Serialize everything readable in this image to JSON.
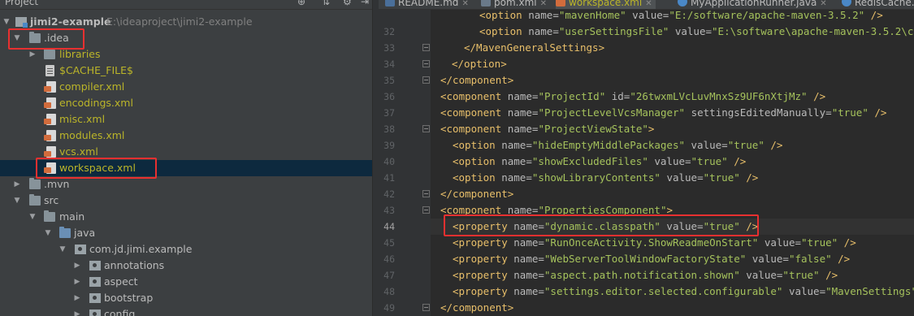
{
  "project_panel": {
    "title": "Project",
    "root": {
      "name": "jimi2-example",
      "path": "E:\\ideaproject\\jimi2-example"
    },
    "rows": [
      {
        "label": ".idea"
      },
      {
        "label": "libraries"
      },
      {
        "label": "$CACHE_FILE$"
      },
      {
        "label": "compiler.xml"
      },
      {
        "label": "encodings.xml"
      },
      {
        "label": "misc.xml"
      },
      {
        "label": "modules.xml"
      },
      {
        "label": "vcs.xml"
      },
      {
        "label": "workspace.xml"
      },
      {
        "label": ".mvn"
      },
      {
        "label": "src"
      },
      {
        "label": "main"
      },
      {
        "label": "java"
      },
      {
        "label": "com.jd.jimi.example"
      },
      {
        "label": "annotations"
      },
      {
        "label": "aspect"
      },
      {
        "label": "bootstrap"
      },
      {
        "label": "config"
      }
    ]
  },
  "tabs": [
    {
      "label": "README.md"
    },
    {
      "label": "pom.xml"
    },
    {
      "label": "workspace.xml"
    },
    {
      "label": "MyApplicationRunner.java"
    },
    {
      "label": "RedisCache."
    }
  ],
  "editor": {
    "lines": [
      {
        "n": "",
        "s": [
          {
            "t": "<option ",
            "c": "t-tag"
          },
          {
            "t": "name=",
            "c": "t-attr"
          },
          {
            "t": "\"mavenHome\" ",
            "c": "t-val"
          },
          {
            "t": "value=",
            "c": "t-attr"
          },
          {
            "t": "\"E:/software/apache-maven-3.5.2\"",
            "c": "t-val"
          },
          {
            "t": " />",
            "c": "t-tag"
          }
        ]
      },
      {
        "n": "32",
        "s": [
          {
            "t": "<option ",
            "c": "t-tag"
          },
          {
            "t": "name=",
            "c": "t-attr"
          },
          {
            "t": "\"userSettingsFile\" ",
            "c": "t-val"
          },
          {
            "t": "value=",
            "c": "t-attr"
          },
          {
            "t": "\"E:\\software\\apache-maven-3.5.2\\conf\\se",
            "c": "t-val"
          }
        ]
      },
      {
        "n": "33",
        "s": [
          {
            "t": "</MavenGeneralSettings>",
            "c": "t-tag"
          }
        ]
      },
      {
        "n": "34",
        "s": [
          {
            "t": "</option>",
            "c": "t-tag"
          }
        ]
      },
      {
        "n": "35",
        "s": [
          {
            "t": "</component>",
            "c": "t-tag"
          }
        ]
      },
      {
        "n": "36",
        "s": [
          {
            "t": "<component ",
            "c": "t-tag"
          },
          {
            "t": "name=",
            "c": "t-attr"
          },
          {
            "t": "\"ProjectId\" ",
            "c": "t-val"
          },
          {
            "t": "id=",
            "c": "t-attr"
          },
          {
            "t": "\"26twxmLVcLuvMnxSz9UF6nXtjMz\"",
            "c": "t-val"
          },
          {
            "t": " />",
            "c": "t-tag"
          }
        ]
      },
      {
        "n": "37",
        "s": [
          {
            "t": "<component ",
            "c": "t-tag"
          },
          {
            "t": "name=",
            "c": "t-attr"
          },
          {
            "t": "\"ProjectLevelVcsManager\" ",
            "c": "t-val"
          },
          {
            "t": "settingsEditedManually=",
            "c": "t-attr"
          },
          {
            "t": "\"true\"",
            "c": "t-val"
          },
          {
            "t": " />",
            "c": "t-tag"
          }
        ]
      },
      {
        "n": "38",
        "s": [
          {
            "t": "<component ",
            "c": "t-tag"
          },
          {
            "t": "name=",
            "c": "t-attr"
          },
          {
            "t": "\"ProjectViewState\"",
            "c": "t-val"
          },
          {
            "t": ">",
            "c": "t-tag"
          }
        ]
      },
      {
        "n": "39",
        "s": [
          {
            "t": "<option ",
            "c": "t-tag"
          },
          {
            "t": "name=",
            "c": "t-attr"
          },
          {
            "t": "\"hideEmptyMiddlePackages\" ",
            "c": "t-val"
          },
          {
            "t": "value=",
            "c": "t-attr"
          },
          {
            "t": "\"true\"",
            "c": "t-val"
          },
          {
            "t": " />",
            "c": "t-tag"
          }
        ]
      },
      {
        "n": "40",
        "s": [
          {
            "t": "<option ",
            "c": "t-tag"
          },
          {
            "t": "name=",
            "c": "t-attr"
          },
          {
            "t": "\"showExcludedFiles\" ",
            "c": "t-val"
          },
          {
            "t": "value=",
            "c": "t-attr"
          },
          {
            "t": "\"true\"",
            "c": "t-val"
          },
          {
            "t": " />",
            "c": "t-tag"
          }
        ]
      },
      {
        "n": "41",
        "s": [
          {
            "t": "<option ",
            "c": "t-tag"
          },
          {
            "t": "name=",
            "c": "t-attr"
          },
          {
            "t": "\"showLibraryContents\" ",
            "c": "t-val"
          },
          {
            "t": "value=",
            "c": "t-attr"
          },
          {
            "t": "\"true\"",
            "c": "t-val"
          },
          {
            "t": " />",
            "c": "t-tag"
          }
        ]
      },
      {
        "n": "42",
        "s": [
          {
            "t": "</component>",
            "c": "t-tag"
          }
        ]
      },
      {
        "n": "43",
        "s": [
          {
            "t": "<component ",
            "c": "t-tag"
          },
          {
            "t": "name=",
            "c": "t-attr"
          },
          {
            "t": "\"PropertiesComponent\"",
            "c": "t-val"
          },
          {
            "t": ">",
            "c": "t-tag"
          }
        ]
      },
      {
        "n": "44",
        "s": [
          {
            "t": "<property ",
            "c": "t-tag"
          },
          {
            "t": "name=",
            "c": "t-attr"
          },
          {
            "t": "\"dynamic.classpath\" ",
            "c": "t-val"
          },
          {
            "t": "value=",
            "c": "t-attr"
          },
          {
            "t": "\"true\"",
            "c": "t-val"
          },
          {
            "t": " />",
            "c": "t-tag"
          }
        ]
      },
      {
        "n": "45",
        "s": [
          {
            "t": "<property ",
            "c": "t-tag"
          },
          {
            "t": "name=",
            "c": "t-attr"
          },
          {
            "t": "\"RunOnceActivity.ShowReadmeOnStart\" ",
            "c": "t-val"
          },
          {
            "t": "value=",
            "c": "t-attr"
          },
          {
            "t": "\"true\"",
            "c": "t-val"
          },
          {
            "t": " />",
            "c": "t-tag"
          }
        ]
      },
      {
        "n": "46",
        "s": [
          {
            "t": "<property ",
            "c": "t-tag"
          },
          {
            "t": "name=",
            "c": "t-attr"
          },
          {
            "t": "\"WebServerToolWindowFactoryState\" ",
            "c": "t-val"
          },
          {
            "t": "value=",
            "c": "t-attr"
          },
          {
            "t": "\"false\"",
            "c": "t-val"
          },
          {
            "t": " />",
            "c": "t-tag"
          }
        ]
      },
      {
        "n": "47",
        "s": [
          {
            "t": "<property ",
            "c": "t-tag"
          },
          {
            "t": "name=",
            "c": "t-attr"
          },
          {
            "t": "\"aspect.path.notification.shown\" ",
            "c": "t-val"
          },
          {
            "t": "value=",
            "c": "t-attr"
          },
          {
            "t": "\"true\"",
            "c": "t-val"
          },
          {
            "t": " />",
            "c": "t-tag"
          }
        ]
      },
      {
        "n": "48",
        "s": [
          {
            "t": "<property ",
            "c": "t-tag"
          },
          {
            "t": "name=",
            "c": "t-attr"
          },
          {
            "t": "\"settings.editor.selected.configurable\" ",
            "c": "t-val"
          },
          {
            "t": "value=",
            "c": "t-attr"
          },
          {
            "t": "\"MavenSettings\"",
            "c": "t-val"
          },
          {
            "t": " />",
            "c": "t-tag"
          }
        ]
      },
      {
        "n": "49",
        "s": [
          {
            "t": "</component>",
            "c": "t-tag"
          }
        ]
      },
      {
        "n": "50",
        "s": []
      }
    ]
  }
}
